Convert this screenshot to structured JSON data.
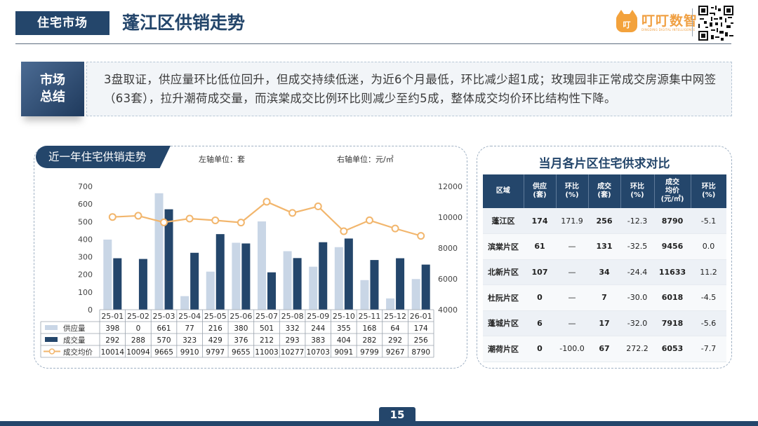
{
  "header": {
    "tag": "住宅市场",
    "title": "蓬江区供销走势"
  },
  "brand": {
    "logo_glyph": "叮",
    "name": "叮叮数智",
    "sub": "DINGDING DIGITAL INTELLIGENCE"
  },
  "summary": {
    "tag_line1": "市场",
    "tag_line2": "总结",
    "text": "3盘取证，供应量环比低位回升，但成交持续低迷，为近6个月最低，环比减少超1成；玫瑰园非正常成交房源集中网签（63套），拉升潮荷成交量，而滨棠成交比例环比则减少至约5成，整体成交均价环比结构性下降。"
  },
  "chart_panel": {
    "tab_label": "近一年住宅供销走势",
    "left_unit": "左轴单位：套",
    "right_unit": "右轴单位：元/㎡"
  },
  "chart_data": {
    "type": "bar",
    "categories": [
      "25-01",
      "25-02",
      "25-03",
      "25-04",
      "25-05",
      "25-06",
      "25-07",
      "25-08",
      "25-09",
      "25-10",
      "25-11",
      "25-12",
      "26-01"
    ],
    "series": [
      {
        "name": "供应量",
        "type": "bar",
        "axis": "left",
        "color": "#c9d6e6",
        "values": [
          398,
          0,
          661,
          77,
          216,
          380,
          501,
          332,
          244,
          355,
          168,
          64,
          174
        ]
      },
      {
        "name": "成交量",
        "type": "bar",
        "axis": "left",
        "color": "#24466b",
        "values": [
          292,
          288,
          570,
          323,
          429,
          376,
          212,
          293,
          383,
          404,
          282,
          292,
          256
        ]
      },
      {
        "name": "成交均价",
        "type": "line",
        "axis": "right",
        "color": "#f2b66d",
        "values": [
          10014,
          10094,
          9665,
          9910,
          9797,
          9655,
          11003,
          10277,
          10703,
          9091,
          9799,
          9267,
          8790
        ]
      }
    ],
    "y_left": {
      "range": [
        0,
        700
      ],
      "ticks": [
        0,
        100,
        200,
        300,
        400,
        500,
        600,
        700
      ]
    },
    "y_right": {
      "range": [
        4000,
        12000
      ],
      "ticks": [
        4000,
        6000,
        8000,
        10000,
        12000
      ]
    },
    "data_table": true,
    "legend": "data-table"
  },
  "district_table": {
    "title": "当月各片区住宅供求对比",
    "headers": [
      [
        "区域"
      ],
      [
        "供应",
        "(套)"
      ],
      [
        "环比",
        "(%)"
      ],
      [
        "成交",
        "(套)"
      ],
      [
        "环比",
        "(%)"
      ],
      [
        "成交",
        "均价",
        "(元/㎡)"
      ],
      [
        "环比",
        "(%)"
      ]
    ],
    "rows": [
      [
        "蓬江区",
        "174",
        "171.9",
        "256",
        "-12.3",
        "8790",
        "-5.1"
      ],
      [
        "滨棠片区",
        "61",
        "—",
        "131",
        "-32.5",
        "9456",
        "0.0"
      ],
      [
        "北新片区",
        "107",
        "—",
        "34",
        "-24.4",
        "11633",
        "11.2"
      ],
      [
        "杜阮片区",
        "0",
        "—",
        "7",
        "-30.0",
        "6018",
        "-4.5"
      ],
      [
        "蓬城片区",
        "6",
        "—",
        "17",
        "-32.0",
        "7918",
        "-5.6"
      ],
      [
        "潮荷片区",
        "0",
        "-100.0",
        "67",
        "272.2",
        "6053",
        "-7.7"
      ]
    ]
  },
  "footer": {
    "page": "15"
  }
}
